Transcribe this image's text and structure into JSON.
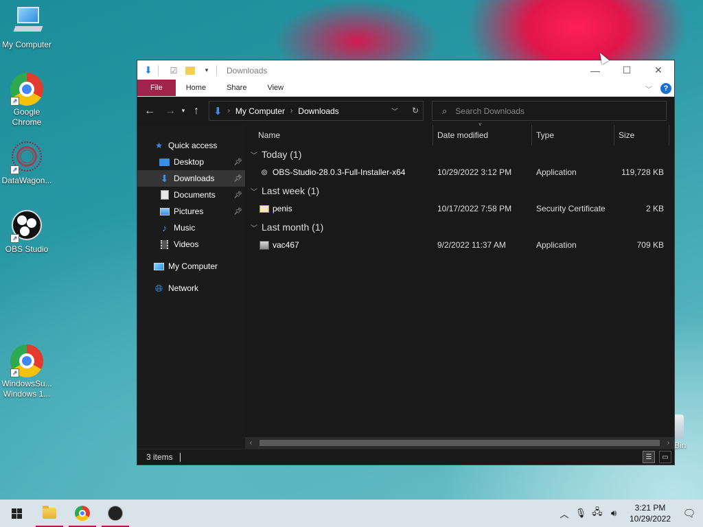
{
  "desktop": {
    "icons": [
      {
        "label_1": "My Computer",
        "label_2": ""
      },
      {
        "label_1": "Google",
        "label_2": "Chrome"
      },
      {
        "label_1": "DataWagon...",
        "label_2": ""
      },
      {
        "label_1": "OBS Studio",
        "label_2": ""
      },
      {
        "label_1": "WindowsSu...",
        "label_2": "Windows 1..."
      }
    ],
    "recycle_label": "Bin"
  },
  "window": {
    "title": "Downloads",
    "controls": {
      "minimize": "—",
      "maximize": "☐",
      "close": "✕"
    },
    "ribbon": {
      "file": "File",
      "home": "Home",
      "share": "Share",
      "view": "View",
      "help": "?"
    },
    "breadcrumb": [
      "My Computer",
      "Downloads"
    ],
    "search_placeholder": "Search Downloads",
    "sidebar": [
      {
        "label": "Quick access"
      },
      {
        "label": "Desktop"
      },
      {
        "label": "Downloads"
      },
      {
        "label": "Documents"
      },
      {
        "label": "Pictures"
      },
      {
        "label": "Music"
      },
      {
        "label": "Videos"
      },
      {
        "label": "My Computer"
      },
      {
        "label": "Network"
      }
    ],
    "columns": {
      "name": "Name",
      "date": "Date modified",
      "type": "Type",
      "size": "Size"
    },
    "groups": [
      {
        "label": "Today (1)",
        "file": {
          "name": "OBS-Studio-28.0.3-Full-Installer-x64",
          "date": "10/29/2022 3:12 PM",
          "type": "Application",
          "size": "119,728 KB"
        }
      },
      {
        "label": "Last week (1)",
        "file": {
          "name": "penis",
          "date": "10/17/2022 7:58 PM",
          "type": "Security Certificate",
          "size": "2 KB"
        }
      },
      {
        "label": "Last month (1)",
        "file": {
          "name": "vac467",
          "date": "9/2/2022 11:37 AM",
          "type": "Application",
          "size": "709 KB"
        }
      }
    ],
    "status": "3 items"
  },
  "taskbar": {
    "time": "3:21 PM",
    "date": "10/29/2022"
  },
  "colors": {
    "accent": "#a0234b",
    "window_bg": "#191919",
    "selection": "#363636"
  }
}
